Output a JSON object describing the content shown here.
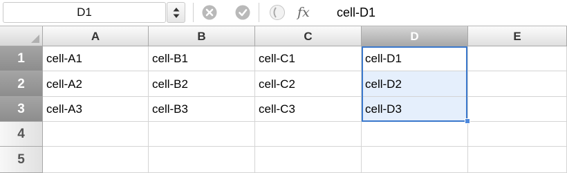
{
  "formula_bar": {
    "name_box": "D1",
    "fx": "fx",
    "formula": "cell-D1",
    "icons": {
      "stepper": "up-down-arrows-icon",
      "cancel": "x-circle-icon",
      "enter": "check-circle-icon",
      "function": "function-wizard-icon"
    }
  },
  "grid": {
    "columns": [
      "A",
      "B",
      "C",
      "D",
      "E"
    ],
    "rows": [
      "1",
      "2",
      "3",
      "4",
      "5"
    ],
    "cells": {
      "A1": "cell-A1",
      "B1": "cell-B1",
      "C1": "cell-C1",
      "D1": "cell-D1",
      "A2": "cell-A2",
      "B2": "cell-B2",
      "C2": "cell-C2",
      "D2": "cell-D2",
      "A3": "cell-A3",
      "B3": "cell-B3",
      "C3": "cell-C3",
      "D3": "cell-D3"
    },
    "selection": "D1:D3",
    "active_cell": "D1"
  },
  "colors": {
    "selection_border": "#3a78cc",
    "selection_fill": "#e5effc",
    "header_selected": "#9a9a9a"
  }
}
